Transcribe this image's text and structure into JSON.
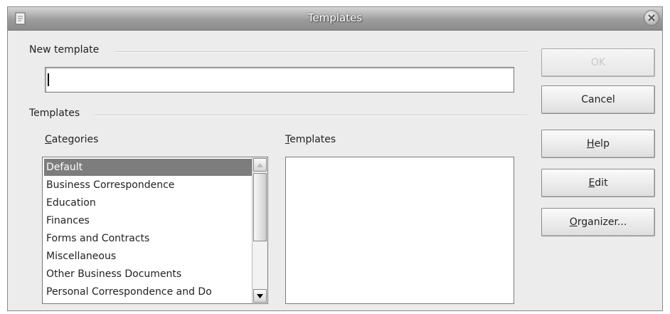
{
  "window": {
    "title": "Templates"
  },
  "new_template": {
    "group_label": "New template",
    "value": ""
  },
  "templates_group": {
    "group_label": "Templates",
    "categories_label": "Categories",
    "templates_label": "Templates",
    "categories": [
      "Default",
      "Business Correspondence",
      "Education",
      "Finances",
      "Forms and Contracts",
      "Miscellaneous",
      "Other Business Documents",
      "Personal Correspondence and Do"
    ],
    "selected_category": "Default"
  },
  "buttons": {
    "ok": "OK",
    "cancel": "Cancel",
    "help": "Help",
    "edit": "Edit",
    "organizer": "Organizer..."
  }
}
